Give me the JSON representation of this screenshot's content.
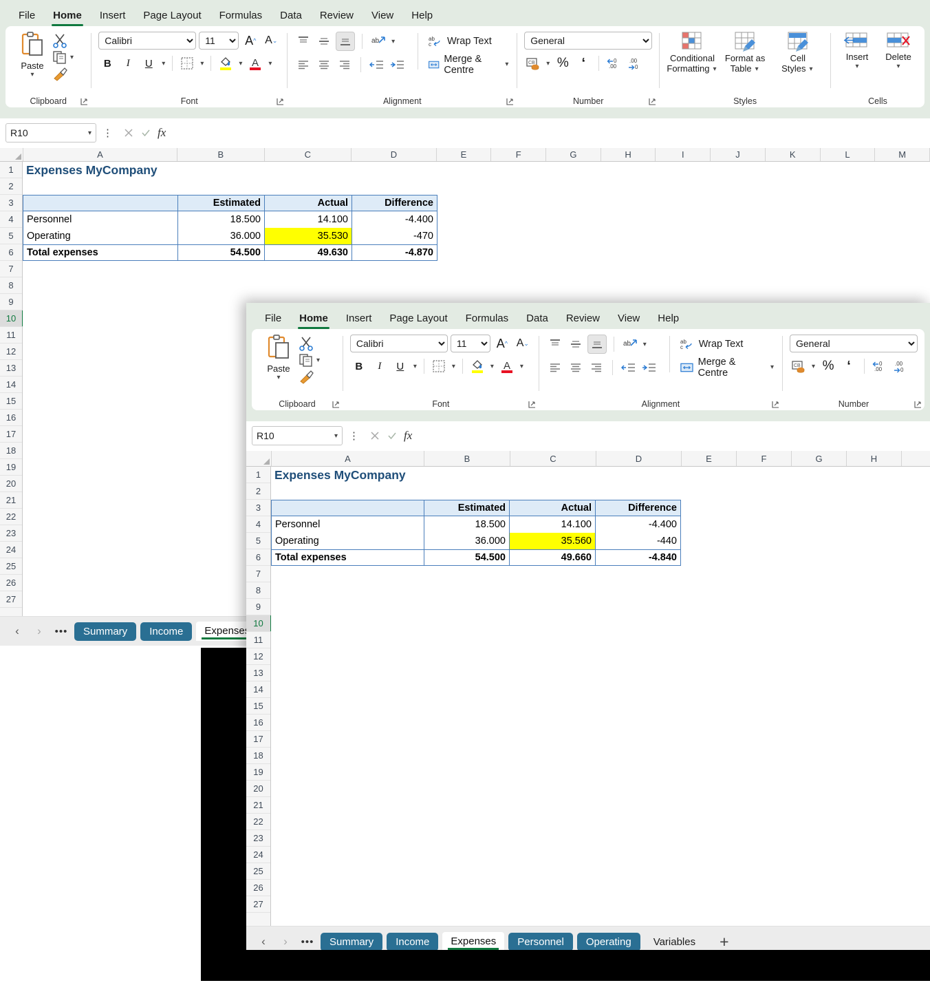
{
  "app": {
    "accent_green": "#10793f",
    "ribbon_bg": "#e3ebe3",
    "tab_blue": "#2a6f93",
    "title_color": "#1f4e79",
    "highlight_yellow": "#ffff00",
    "header_fill": "#deebf7"
  },
  "ribbon": {
    "tabs": [
      {
        "label": "File",
        "active": false
      },
      {
        "label": "Home",
        "active": true
      },
      {
        "label": "Insert",
        "active": false
      },
      {
        "label": "Page Layout",
        "active": false
      },
      {
        "label": "Formulas",
        "active": false
      },
      {
        "label": "Data",
        "active": false
      },
      {
        "label": "Review",
        "active": false
      },
      {
        "label": "View",
        "active": false
      },
      {
        "label": "Help",
        "active": false
      }
    ],
    "clipboard": {
      "group_label": "Clipboard",
      "paste_label": "Paste",
      "cut_icon": "scissors-icon",
      "copy_icon": "copy-icon",
      "format_painter_icon": "format-painter-icon",
      "dialog_launcher": "dialog-launcher-icon"
    },
    "font": {
      "group_label": "Font",
      "font_family_value": "Calibri",
      "font_size_value": "11",
      "grow_font": "A",
      "shrink_font": "A",
      "bold": "B",
      "italic": "I",
      "underline": "U",
      "borders_icon": "borders-icon",
      "fill_color_icon": "fill-color-icon",
      "font_color_icon": "font-color-icon",
      "dialog_launcher": "dialog-launcher-icon"
    },
    "alignment": {
      "group_label": "Alignment",
      "wrap_text_label": "Wrap Text",
      "merge_centre_label": "Merge & Centre",
      "orientation_icon": "text-orientation-icon",
      "align_top_icon": "align-top-icon",
      "align_middle_icon": "align-middle-icon",
      "align_bottom_icon": "align-bottom-icon",
      "align_left_icon": "align-left-icon",
      "align_center_icon": "align-center-icon",
      "align_right_icon": "align-right-icon",
      "decrease_indent_icon": "decrease-indent-icon",
      "increase_indent_icon": "increase-indent-icon",
      "dialog_launcher": "dialog-launcher-icon"
    },
    "number": {
      "group_label": "Number",
      "format_value": "General",
      "accounting_icon": "accounting-format-icon",
      "percent_label": "%",
      "comma_label": "‘",
      "increase_decimal_icon": "increase-decimal-icon",
      "decrease_decimal_icon": "decrease-decimal-icon",
      "dialog_launcher": "dialog-launcher-icon"
    },
    "styles": {
      "group_label": "Styles",
      "conditional_formatting_line1": "Conditional",
      "conditional_formatting_line2": "Formatting",
      "format_as_table_line1": "Format as",
      "format_as_table_line2": "Table",
      "cell_styles_line1": "Cell",
      "cell_styles_line2": "Styles"
    },
    "cells": {
      "group_label": "Cells",
      "insert_label": "Insert",
      "delete_label": "Delete"
    }
  },
  "formula_bar": {
    "name_box_value": "R10",
    "cancel_icon": "cancel-icon",
    "enter_icon": "enter-icon",
    "function_icon": "insert-function-icon",
    "formula_value": "",
    "more_icon": "more-options-icon"
  },
  "back_window": {
    "columns": [
      "A",
      "B",
      "C",
      "D",
      "E",
      "F",
      "G",
      "H",
      "I",
      "J",
      "K",
      "L",
      "M"
    ],
    "rows": [
      "1",
      "2",
      "3",
      "4",
      "5",
      "6",
      "7",
      "8",
      "9",
      "10",
      "11",
      "12",
      "13",
      "14",
      "15",
      "16",
      "17",
      "18",
      "19",
      "20",
      "21",
      "22",
      "23",
      "24",
      "25",
      "26",
      "27"
    ],
    "selected_row": "10",
    "sheet_title": "Expenses MyCompany",
    "table": {
      "headers": [
        "",
        "Estimated",
        "Actual",
        "Difference"
      ],
      "rows": [
        {
          "label": "Personnel",
          "estimated": "18.500",
          "actual": "14.100",
          "difference": "-4.400",
          "highlight": false
        },
        {
          "label": "Operating",
          "estimated": "36.000",
          "actual": "35.530",
          "difference": "-470",
          "highlight": true
        }
      ],
      "total": {
        "label": "Total expenses",
        "estimated": "54.500",
        "actual": "49.630",
        "difference": "-4.870"
      }
    },
    "sheet_tabs": [
      {
        "label": "Summary",
        "state": "normal"
      },
      {
        "label": "Income",
        "state": "normal"
      },
      {
        "label": "Expenses",
        "state": "clipped"
      }
    ],
    "nav_prev_icon": "chevron-left-icon",
    "nav_next_icon": "chevron-right-icon",
    "nav_more_icon": "ellipsis-icon"
  },
  "front_window": {
    "columns": [
      "A",
      "B",
      "C",
      "D",
      "E",
      "F",
      "G",
      "H"
    ],
    "rows": [
      "1",
      "2",
      "3",
      "4",
      "5",
      "6",
      "7",
      "8",
      "9",
      "10",
      "11",
      "12",
      "13",
      "14",
      "15",
      "16",
      "17",
      "18",
      "19",
      "20",
      "21",
      "22",
      "23",
      "24",
      "25",
      "26",
      "27"
    ],
    "selected_row": "10",
    "sheet_title": "Expenses MyCompany",
    "table": {
      "headers": [
        "",
        "Estimated",
        "Actual",
        "Difference"
      ],
      "rows": [
        {
          "label": "Personnel",
          "estimated": "18.500",
          "actual": "14.100",
          "difference": "-4.400",
          "highlight": false
        },
        {
          "label": "Operating",
          "estimated": "36.000",
          "actual": "35.560",
          "difference": "-440",
          "highlight": true
        }
      ],
      "total": {
        "label": "Total expenses",
        "estimated": "54.500",
        "actual": "49.660",
        "difference": "-4.840"
      }
    },
    "sheet_tabs": [
      {
        "label": "Summary",
        "state": "normal"
      },
      {
        "label": "Income",
        "state": "normal"
      },
      {
        "label": "Expenses",
        "state": "active"
      },
      {
        "label": "Personnel",
        "state": "normal"
      },
      {
        "label": "Operating",
        "state": "normal"
      },
      {
        "label": "Variables",
        "state": "plain"
      }
    ],
    "add_sheet_label": "+",
    "nav_prev_icon": "chevron-left-icon",
    "nav_next_icon": "chevron-right-icon",
    "nav_more_icon": "ellipsis-icon"
  }
}
